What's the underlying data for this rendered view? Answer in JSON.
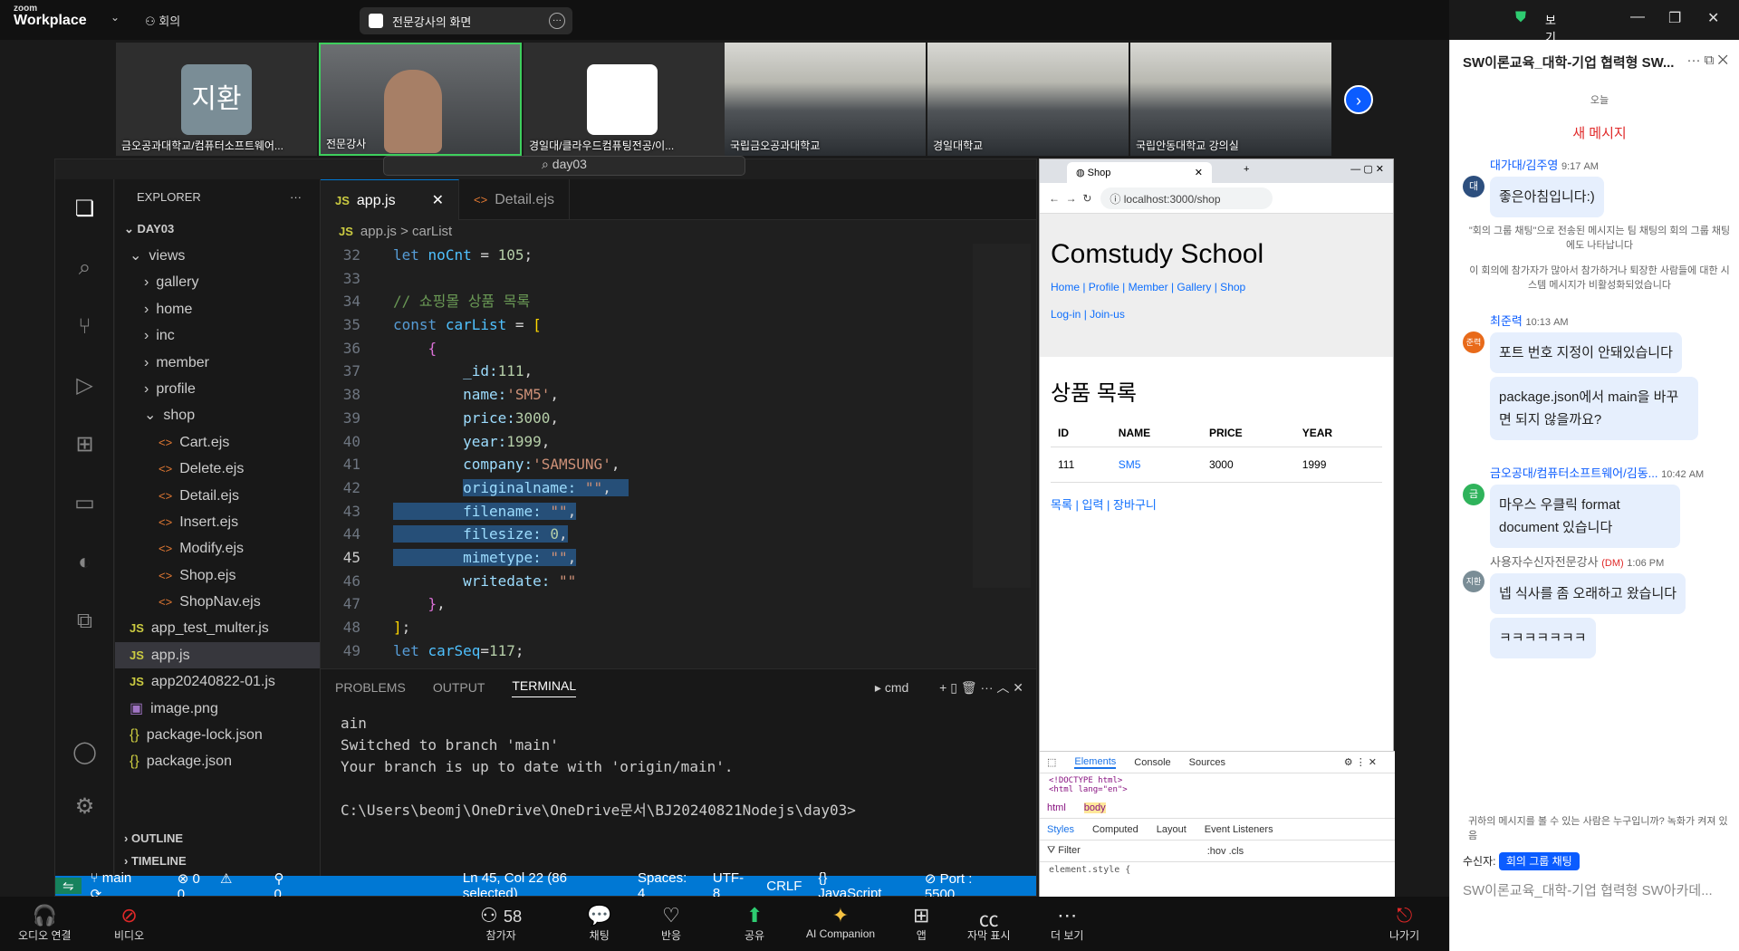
{
  "zoom": {
    "logo_small": "zoom",
    "logo": "Workplace",
    "meeting": "회의",
    "share_title": "전문강사의 화면",
    "view": "보기",
    "participants": [
      {
        "name": "금오공과대학교/컴퓨터소프트웨어..."
      },
      {
        "name": "전문강사"
      },
      {
        "name": "경일대/클라우드컴퓨팅전공/이..."
      },
      {
        "name": "국립금오공과대학교"
      },
      {
        "name": "경일대학교"
      },
      {
        "name": "국립안동대학교 강의실"
      }
    ],
    "avatar_initial": "지환",
    "toolbar": [
      {
        "label": "오디오 연결",
        "icon": "headset-icon"
      },
      {
        "label": "비디오",
        "icon": "video-off-icon"
      },
      {
        "label": "참가자",
        "icon": "people-icon",
        "count": "58"
      },
      {
        "label": "채팅",
        "icon": "chat-icon"
      },
      {
        "label": "반응",
        "icon": "heart-icon"
      },
      {
        "label": "공유",
        "icon": "share-icon"
      },
      {
        "label": "AI Companion",
        "icon": "sparkle-icon"
      },
      {
        "label": "앱",
        "icon": "apps-icon"
      },
      {
        "label": "자막 표시",
        "icon": "cc-icon"
      },
      {
        "label": "더 보기",
        "icon": "more-icon"
      },
      {
        "label": "나가기",
        "icon": "leave-icon"
      }
    ]
  },
  "vscode": {
    "search": "day03",
    "explorer": "EXPLORER",
    "folder": "DAY03",
    "tree": [
      {
        "label": "views",
        "type": "folder-open",
        "indent": 1
      },
      {
        "label": "gallery",
        "type": "folder",
        "indent": 2
      },
      {
        "label": "home",
        "type": "folder",
        "indent": 2
      },
      {
        "label": "inc",
        "type": "folder",
        "indent": 2
      },
      {
        "label": "member",
        "type": "folder",
        "indent": 2
      },
      {
        "label": "profile",
        "type": "folder",
        "indent": 2
      },
      {
        "label": "shop",
        "type": "folder-open",
        "indent": 2
      },
      {
        "label": "Cart.ejs",
        "type": "ejs",
        "indent": 3
      },
      {
        "label": "Delete.ejs",
        "type": "ejs",
        "indent": 3
      },
      {
        "label": "Detail.ejs",
        "type": "ejs",
        "indent": 3
      },
      {
        "label": "Insert.ejs",
        "type": "ejs",
        "indent": 3
      },
      {
        "label": "Modify.ejs",
        "type": "ejs",
        "indent": 3
      },
      {
        "label": "Shop.ejs",
        "type": "ejs",
        "indent": 3
      },
      {
        "label": "ShopNav.ejs",
        "type": "ejs",
        "indent": 3
      },
      {
        "label": "app_test_multer.js",
        "type": "js",
        "indent": 1
      },
      {
        "label": "app.js",
        "type": "js",
        "indent": 1,
        "selected": true
      },
      {
        "label": "app20240822-01.js",
        "type": "js",
        "indent": 1
      },
      {
        "label": "image.png",
        "type": "img",
        "indent": 1
      },
      {
        "label": "package-lock.json",
        "type": "json",
        "indent": 1
      },
      {
        "label": "package.json",
        "type": "json",
        "indent": 1
      }
    ],
    "outline": "OUTLINE",
    "timeline": "TIMELINE",
    "tabs": [
      {
        "label": "app.js",
        "prefix": "JS",
        "active": true
      },
      {
        "label": "Detail.ejs",
        "prefix": "<>",
        "active": false
      }
    ],
    "breadcrumb": {
      "file": "app.js",
      "sep": ">",
      "symbol": "carList"
    },
    "lines": [
      {
        "n": "32",
        "html": "<span class='kw'>let</span> <span class='vr'>noCnt</span> <span class='pu'>=</span> <span class='nu'>105</span><span class='pu'>;</span>"
      },
      {
        "n": "33",
        "html": ""
      },
      {
        "n": "34",
        "html": "<span class='cm'>// 쇼핑몰 상품 목록</span>"
      },
      {
        "n": "35",
        "html": "<span class='kw'>const</span> <span class='vr'>carList</span> <span class='pu'>=</span> <span class='br2'>[</span>"
      },
      {
        "n": "36",
        "html": "    <span class='br'>{</span>"
      },
      {
        "n": "37",
        "html": "        _id:<span class='nu'>111</span><span class='pu'>,</span>"
      },
      {
        "n": "38",
        "html": "        name:<span class='st'>'SM5'</span><span class='pu'>,</span>"
      },
      {
        "n": "39",
        "html": "        price:<span class='nu'>3000</span><span class='pu'>,</span>"
      },
      {
        "n": "40",
        "html": "        year:<span class='nu'>1999</span><span class='pu'>,</span>"
      },
      {
        "n": "41",
        "html": "        company:<span class='st'>'SAMSUNG'</span><span class='pu'>,</span>"
      },
      {
        "n": "42",
        "html": "        <span class='hl'>originalname: <span class='st'>\"\"</span><span class='pu'>,</span>  </span>"
      },
      {
        "n": "43",
        "html": "<span class='hl'>        filename: <span class='st'>\"\"</span><span class='pu'>,</span></span>"
      },
      {
        "n": "44",
        "html": "<span class='hl'>        filesize: <span class='nu'>0</span><span class='pu'>,</span></span>"
      },
      {
        "n": "45",
        "html": "<span class='hl'>        mimetype: <span class='st'>\"\"</span><span class='pu'>,</span></span>",
        "cur": true
      },
      {
        "n": "46",
        "html": "        writedate: <span class='st'>\"\"</span>"
      },
      {
        "n": "47",
        "html": "    <span class='br'>}</span><span class='pu'>,</span>"
      },
      {
        "n": "48",
        "html": "<span class='br2'>]</span><span class='pu'>;</span>"
      },
      {
        "n": "49",
        "html": "<span class='kw'>let</span> <span class='vr'>carSeq</span><span class='pu'>=</span><span class='nu'>117</span><span class='pu'>;</span>"
      }
    ],
    "panel_tabs": [
      "PROBLEMS",
      "OUTPUT",
      "TERMINAL"
    ],
    "shell": "cmd",
    "terminal": "ain\nSwitched to branch 'main'\nYour branch is up to date with 'origin/main'.\n\nC:\\Users\\beomj\\OneDrive\\OneDrive문서\\BJ20240821Nodejs\\day03>",
    "status": {
      "branch": "main",
      "errors": "0",
      "warnings": "0",
      "ports": "0",
      "position": "Ln 45, Col 22 (86 selected)",
      "spaces": "Spaces: 4",
      "encoding": "UTF-8",
      "eol": "CRLF",
      "lang": "JavaScript",
      "port": "Port : 5500"
    }
  },
  "browser": {
    "tab": "Shop",
    "url": "localhost:3000/shop",
    "title": "Comstudy School",
    "nav1": "Home | Profile | Member | Gallery | Shop",
    "nav2": "Log-in | Join-us",
    "section": "상품 목록",
    "columns": [
      "ID",
      "NAME",
      "PRICE",
      "YEAR"
    ],
    "rows": [
      [
        "111",
        "SM5",
        "3000",
        "1999"
      ]
    ],
    "links": "목록 | 입력 | 장바구니",
    "devtabs": [
      "Elements",
      "Console",
      "Sources"
    ],
    "dom1": "<!DOCTYPE html>",
    "dom2": "<html lang=\"en\">",
    "crumbs": [
      "html",
      "body"
    ],
    "styletabs": [
      "Styles",
      "Computed",
      "Layout",
      "Event Listeners"
    ],
    "filter": "Filter",
    "hov": ":hov  .cls",
    "elstyle": "element.style {"
  },
  "chat": {
    "title": "SW이론교육_대학-기업 협력형 SW...",
    "time_label": "오늘",
    "new": "새 메시지",
    "m1": {
      "name": "대가대/김주영",
      "time": "9:17 AM",
      "text": "좋은아침입니다:)",
      "avatar": "대"
    },
    "sys1": "\"회의 그룹 채팅\"으로 전송된 메시지는 팀 채팅의 회의 그룹 채팅에도 나타납니다",
    "sys2": "이 회의에 참가자가 많아서 참가하거나 퇴장한 사람들에 대한 시스템 메시지가 비활성화되었습니다",
    "m2": {
      "name": "최준력",
      "time": "10:13 AM",
      "text1": "포트 번호 지정이 안돼있습니다",
      "text2": "package.json에서 main을 바꾸면 되지 않을까요?",
      "avatar": "준력"
    },
    "m3": {
      "name": "금오공대/컴퓨터소프트웨어/김동...",
      "time": "10:42 AM",
      "text": "마우스 우클릭 format document 있습니다",
      "avatar": "금"
    },
    "m4": {
      "name": "사용자수신자전문강사",
      "dm": "(DM)",
      "time": "1:06 PM",
      "text1": "넵 식사를 좀 오래하고 왔습니다",
      "text2": "ㅋㅋㅋㅋㅋㅋㅋ",
      "avatar": "지환"
    },
    "notice": "귀하의 메시지를 볼 수 있는 사람은 누구입니까? 녹화가 켜져 있음",
    "to_label": "수신자:",
    "to": "회의 그룹 채팅",
    "input": "SW이론교육_대학-기업 협력형 SW아카데..."
  }
}
